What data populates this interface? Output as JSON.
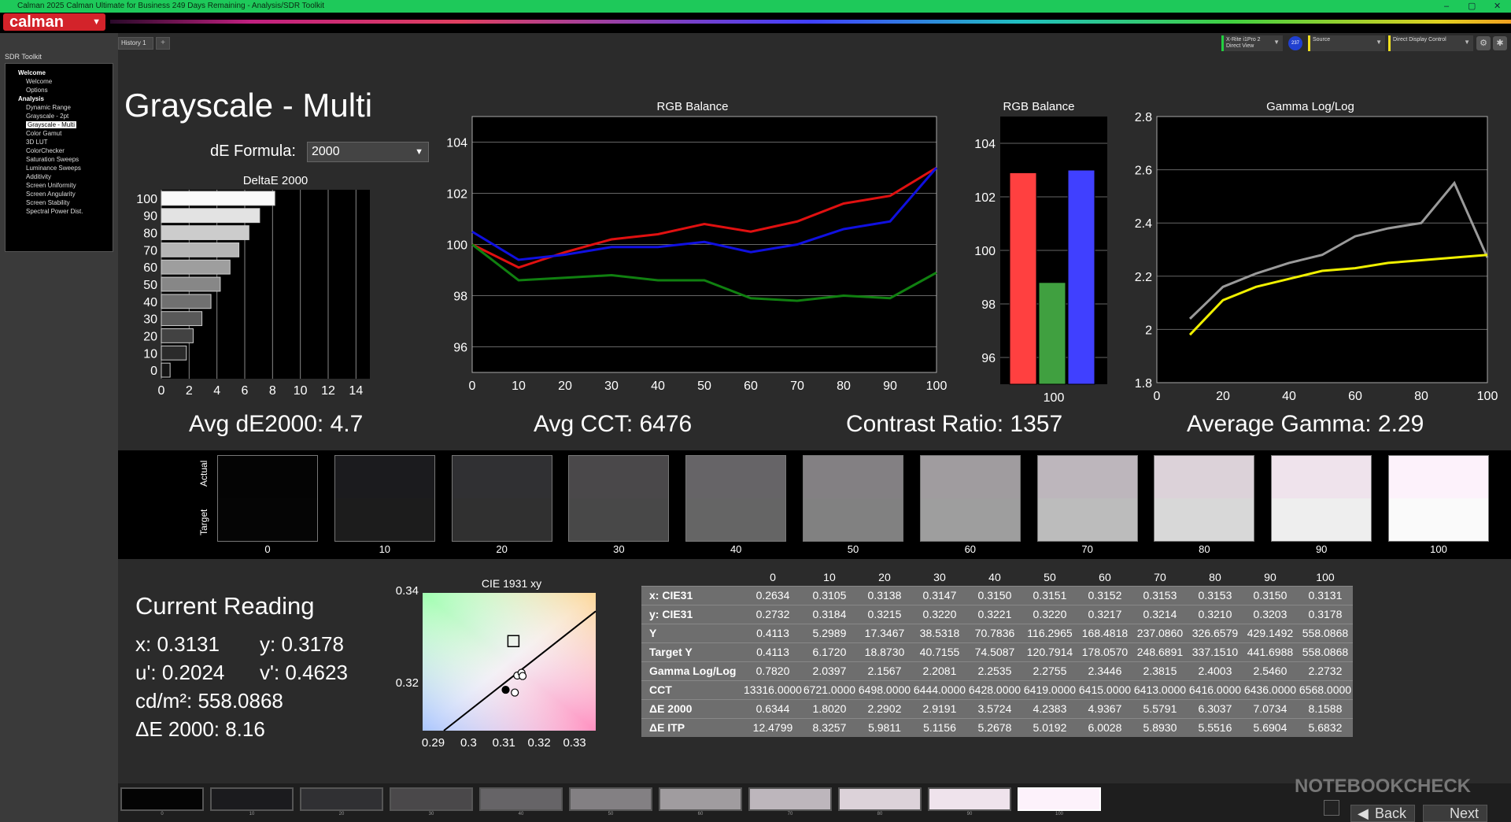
{
  "window": {
    "title": "Calman 2025 Calman Ultimate for Business 249 Days Remaining  - Analysis/SDR Toolkit",
    "min": "–",
    "max": "▢",
    "close": "✕"
  },
  "app": {
    "logo": "calman"
  },
  "history": {
    "tab": "History 1",
    "add": "+"
  },
  "devices": {
    "meter": "X-Rite i1Pro 2\nDirect View",
    "meter_badge": "237",
    "source": "Source",
    "display": "Direct Display Control"
  },
  "sidebar": {
    "title": "SDR Toolkit",
    "items": [
      {
        "label": "Welcome",
        "type": "hdr"
      },
      {
        "label": "Welcome"
      },
      {
        "label": "Options"
      },
      {
        "label": "Analysis",
        "type": "hdr"
      },
      {
        "label": "Dynamic Range"
      },
      {
        "label": "Grayscale - 2pt"
      },
      {
        "label": "Grayscale - Multi",
        "selected": true
      },
      {
        "label": "Color Gamut"
      },
      {
        "label": "3D LUT"
      },
      {
        "label": "ColorChecker"
      },
      {
        "label": "Saturation Sweeps"
      },
      {
        "label": "Luminance Sweeps"
      },
      {
        "label": "Additivity"
      },
      {
        "label": "Screen Uniformity"
      },
      {
        "label": "Screen Angularity"
      },
      {
        "label": "Screen Stability"
      },
      {
        "label": "Spectral Power Dist."
      }
    ]
  },
  "page": {
    "title": "Grayscale - Multi",
    "de_label": "dE Formula:",
    "de_value": "2000"
  },
  "summary": {
    "avg_de": "Avg dE2000: 4.7",
    "avg_cct": "Avg CCT: 6476",
    "contrast": "Contrast Ratio: 1357",
    "gamma": "Average Gamma: 2.29"
  },
  "chart_data": [
    {
      "type": "bar",
      "title": "DeltaE 2000",
      "categories": [
        "100",
        "90",
        "80",
        "70",
        "60",
        "50",
        "40",
        "30",
        "20",
        "10",
        "0"
      ],
      "values": [
        8.16,
        7.07,
        6.3,
        5.58,
        4.94,
        4.24,
        3.57,
        2.92,
        2.29,
        1.8,
        0.63
      ],
      "xticks": [
        "0",
        "2",
        "4",
        "6",
        "8",
        "10",
        "12",
        "14"
      ],
      "xlim": [
        0,
        15
      ]
    },
    {
      "type": "line",
      "title": "RGB Balance",
      "x": [
        0,
        10,
        20,
        30,
        40,
        50,
        60,
        70,
        80,
        90,
        100
      ],
      "ylim": [
        95,
        105
      ],
      "yticks": [
        "96",
        "98",
        "100",
        "102",
        "104"
      ],
      "xticks": [
        "0",
        "10",
        "20",
        "30",
        "40",
        "50",
        "60",
        "70",
        "80",
        "90",
        "100"
      ],
      "series": [
        {
          "color": "#e01010",
          "values": [
            100.0,
            99.1,
            99.7,
            100.2,
            100.4,
            100.8,
            100.5,
            100.9,
            101.6,
            101.9,
            103.0
          ]
        },
        {
          "color": "#108010",
          "values": [
            100.0,
            98.6,
            98.7,
            98.8,
            98.6,
            98.6,
            97.9,
            97.8,
            98.0,
            97.9,
            98.9
          ]
        },
        {
          "color": "#1010e0",
          "values": [
            100.5,
            99.4,
            99.6,
            99.9,
            99.9,
            100.1,
            99.7,
            100.0,
            100.6,
            100.9,
            103.0
          ]
        }
      ]
    },
    {
      "type": "bar",
      "title": "RGB Balance",
      "categories": [
        "100"
      ],
      "ylim": [
        95,
        105
      ],
      "yticks": [
        "96",
        "98",
        "100",
        "102",
        "104"
      ],
      "series": [
        {
          "color": "#ff4040",
          "values": [
            102.9
          ]
        },
        {
          "color": "#40a040",
          "values": [
            98.8
          ]
        },
        {
          "color": "#4040ff",
          "values": [
            103.0
          ]
        }
      ]
    },
    {
      "type": "line",
      "title": "Gamma Log/Log",
      "x": [
        10,
        20,
        30,
        40,
        50,
        60,
        70,
        80,
        90,
        100
      ],
      "ylim": [
        1.8,
        2.8
      ],
      "yticks": [
        "1.8",
        "2",
        "2.2",
        "2.4",
        "2.6",
        "2.8"
      ],
      "xticks": [
        "0",
        "20",
        "40",
        "60",
        "80",
        "100"
      ],
      "series": [
        {
          "color": "#9a9a9a",
          "values": [
            2.04,
            2.16,
            2.21,
            2.25,
            2.28,
            2.35,
            2.38,
            2.4,
            2.55,
            2.27
          ]
        },
        {
          "color": "#f0f000",
          "values": [
            1.98,
            2.11,
            2.16,
            2.19,
            2.22,
            2.23,
            2.25,
            2.26,
            2.27,
            2.28
          ]
        }
      ]
    },
    {
      "type": "scatter",
      "title": "CIE 1931 xy",
      "xticks": [
        "0.29",
        "0.3",
        "0.31",
        "0.32",
        "0.33"
      ],
      "yticks": [
        "0.34",
        "0.32"
      ],
      "target": {
        "x": 0.3127,
        "y": 0.329
      }
    }
  ],
  "swatches": {
    "row_labels": [
      "Actual",
      "Target"
    ],
    "items": [
      {
        "label": "0",
        "actual": "#040404",
        "target": "#050505"
      },
      {
        "label": "10",
        "actual": "#1b1b1e",
        "target": "#1c1c1c"
      },
      {
        "label": "20",
        "actual": "#303033",
        "target": "#303030"
      },
      {
        "label": "30",
        "actual": "#4a484a",
        "target": "#484848"
      },
      {
        "label": "40",
        "actual": "#666467",
        "target": "#656565"
      },
      {
        "label": "50",
        "actual": "#838083",
        "target": "#818181"
      },
      {
        "label": "60",
        "actual": "#a09c9f",
        "target": "#9e9e9e"
      },
      {
        "label": "70",
        "actual": "#bdb6bc",
        "target": "#bcbcbc"
      },
      {
        "label": "80",
        "actual": "#dcd2d9",
        "target": "#d8d8d8"
      },
      {
        "label": "90",
        "actual": "#efe3ec",
        "target": "#eeeeee"
      },
      {
        "label": "100",
        "actual": "#fdf2fb",
        "target": "#fafafa"
      }
    ]
  },
  "reading": {
    "title": "Current Reading",
    "x": "x: 0.3131",
    "y": "y: 0.3178",
    "u": "u': 0.2024",
    "v": "v': 0.4623",
    "cdm2": "cd/m²: 558.0868",
    "de": "ΔE 2000: 8.16"
  },
  "table": {
    "headers": [
      "",
      "0",
      "10",
      "20",
      "30",
      "40",
      "50",
      "60",
      "70",
      "80",
      "90",
      "100"
    ],
    "rows": [
      [
        "x: CIE31",
        "0.2634",
        "0.3105",
        "0.3138",
        "0.3147",
        "0.3150",
        "0.3151",
        "0.3152",
        "0.3153",
        "0.3153",
        "0.3150",
        "0.3131"
      ],
      [
        "y: CIE31",
        "0.2732",
        "0.3184",
        "0.3215",
        "0.3220",
        "0.3221",
        "0.3220",
        "0.3217",
        "0.3214",
        "0.3210",
        "0.3203",
        "0.3178"
      ],
      [
        "Y",
        "0.4113",
        "5.2989",
        "17.3467",
        "38.5318",
        "70.7836",
        "116.2965",
        "168.4818",
        "237.0860",
        "326.6579",
        "429.1492",
        "558.0868"
      ],
      [
        "Target Y",
        "0.4113",
        "6.1720",
        "18.8730",
        "40.7155",
        "74.5087",
        "120.7914",
        "178.0570",
        "248.6891",
        "337.1510",
        "441.6988",
        "558.0868"
      ],
      [
        "Gamma Log/Log",
        "0.7820",
        "2.0397",
        "2.1567",
        "2.2081",
        "2.2535",
        "2.2755",
        "2.3446",
        "2.3815",
        "2.4003",
        "2.5460",
        "2.2732"
      ],
      [
        "CCT",
        "13316.0000",
        "6721.0000",
        "6498.0000",
        "6444.0000",
        "6428.0000",
        "6419.0000",
        "6415.0000",
        "6413.0000",
        "6416.0000",
        "6436.0000",
        "6568.0000"
      ],
      [
        "ΔE 2000",
        "0.6344",
        "1.8020",
        "2.2902",
        "2.9191",
        "3.5724",
        "4.2383",
        "4.9367",
        "5.5791",
        "6.3037",
        "7.0734",
        "8.1588"
      ],
      [
        "ΔE ITP",
        "12.4799",
        "8.3257",
        "5.9811",
        "5.1156",
        "5.2678",
        "5.0192",
        "6.0028",
        "5.8930",
        "5.5516",
        "5.6904",
        "5.6832"
      ]
    ]
  },
  "bottom": {
    "labels": [
      "0",
      "10",
      "20",
      "30",
      "40",
      "50",
      "60",
      "70",
      "80",
      "90",
      "100"
    ],
    "back": "Back",
    "next": "Next",
    "watermark": "NOTEBOOKCHECK"
  }
}
